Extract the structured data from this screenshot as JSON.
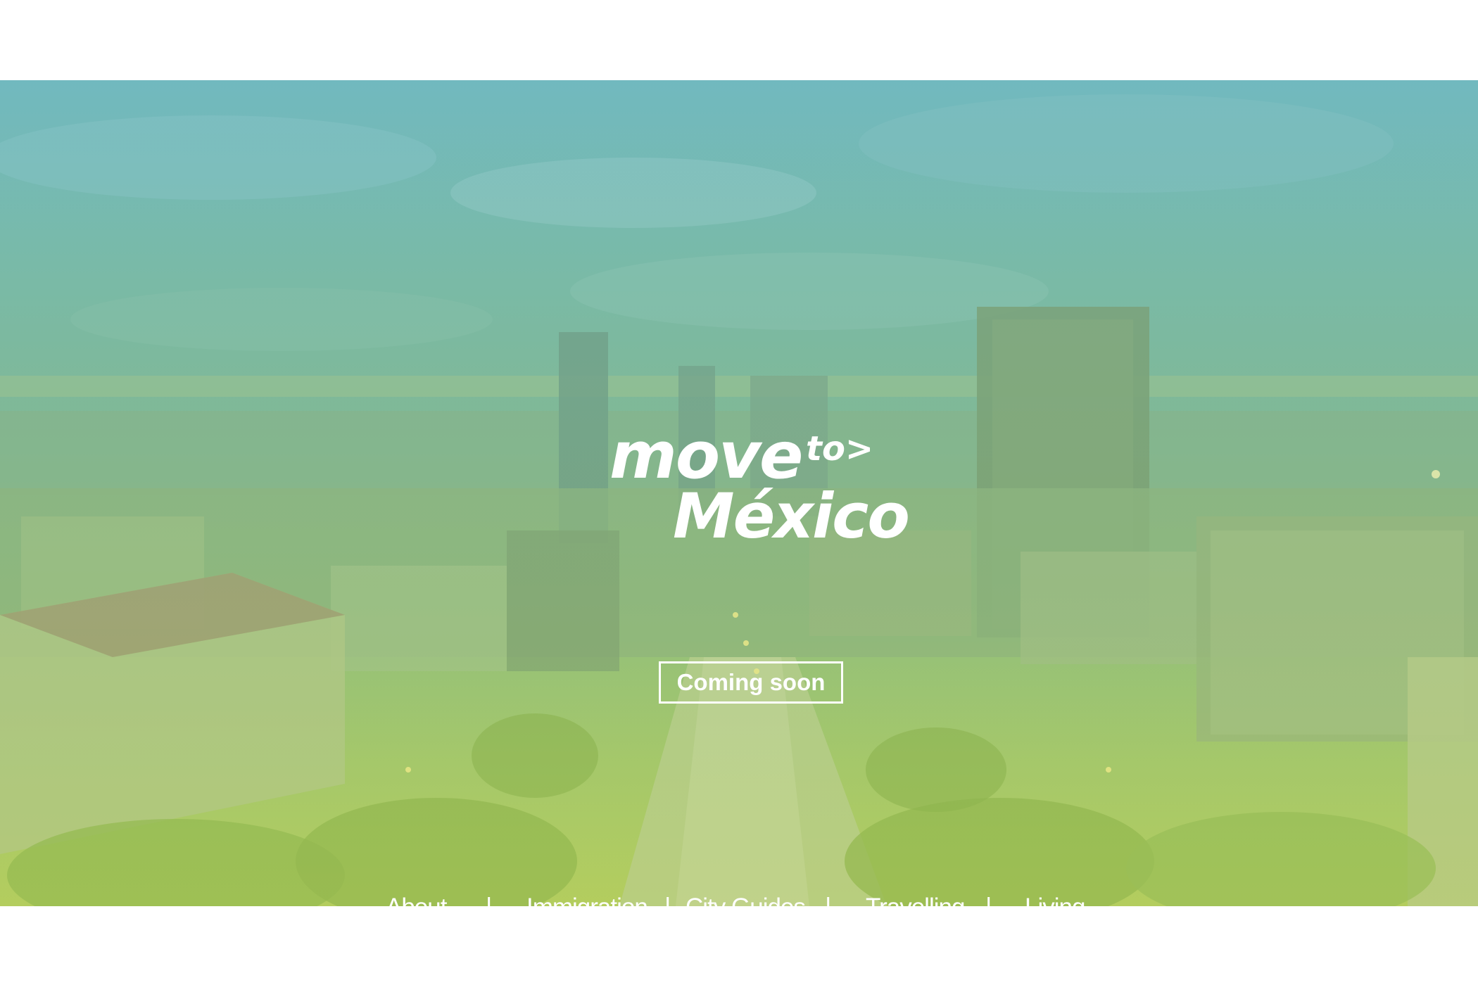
{
  "brand": {
    "line1": "move",
    "line2": "to>",
    "line3": "México"
  },
  "cta": {
    "label": "Coming soon"
  },
  "nav": {
    "items": [
      {
        "label": "About"
      },
      {
        "label": "Immigration"
      },
      {
        "label": "City Guides"
      },
      {
        "label": "Travelling"
      },
      {
        "label": "Living"
      }
    ],
    "separator": "|"
  },
  "colors": {
    "overlay_top": "#6fb7bf",
    "overlay_bottom": "#b1cc5f",
    "text": "#ffffff"
  }
}
